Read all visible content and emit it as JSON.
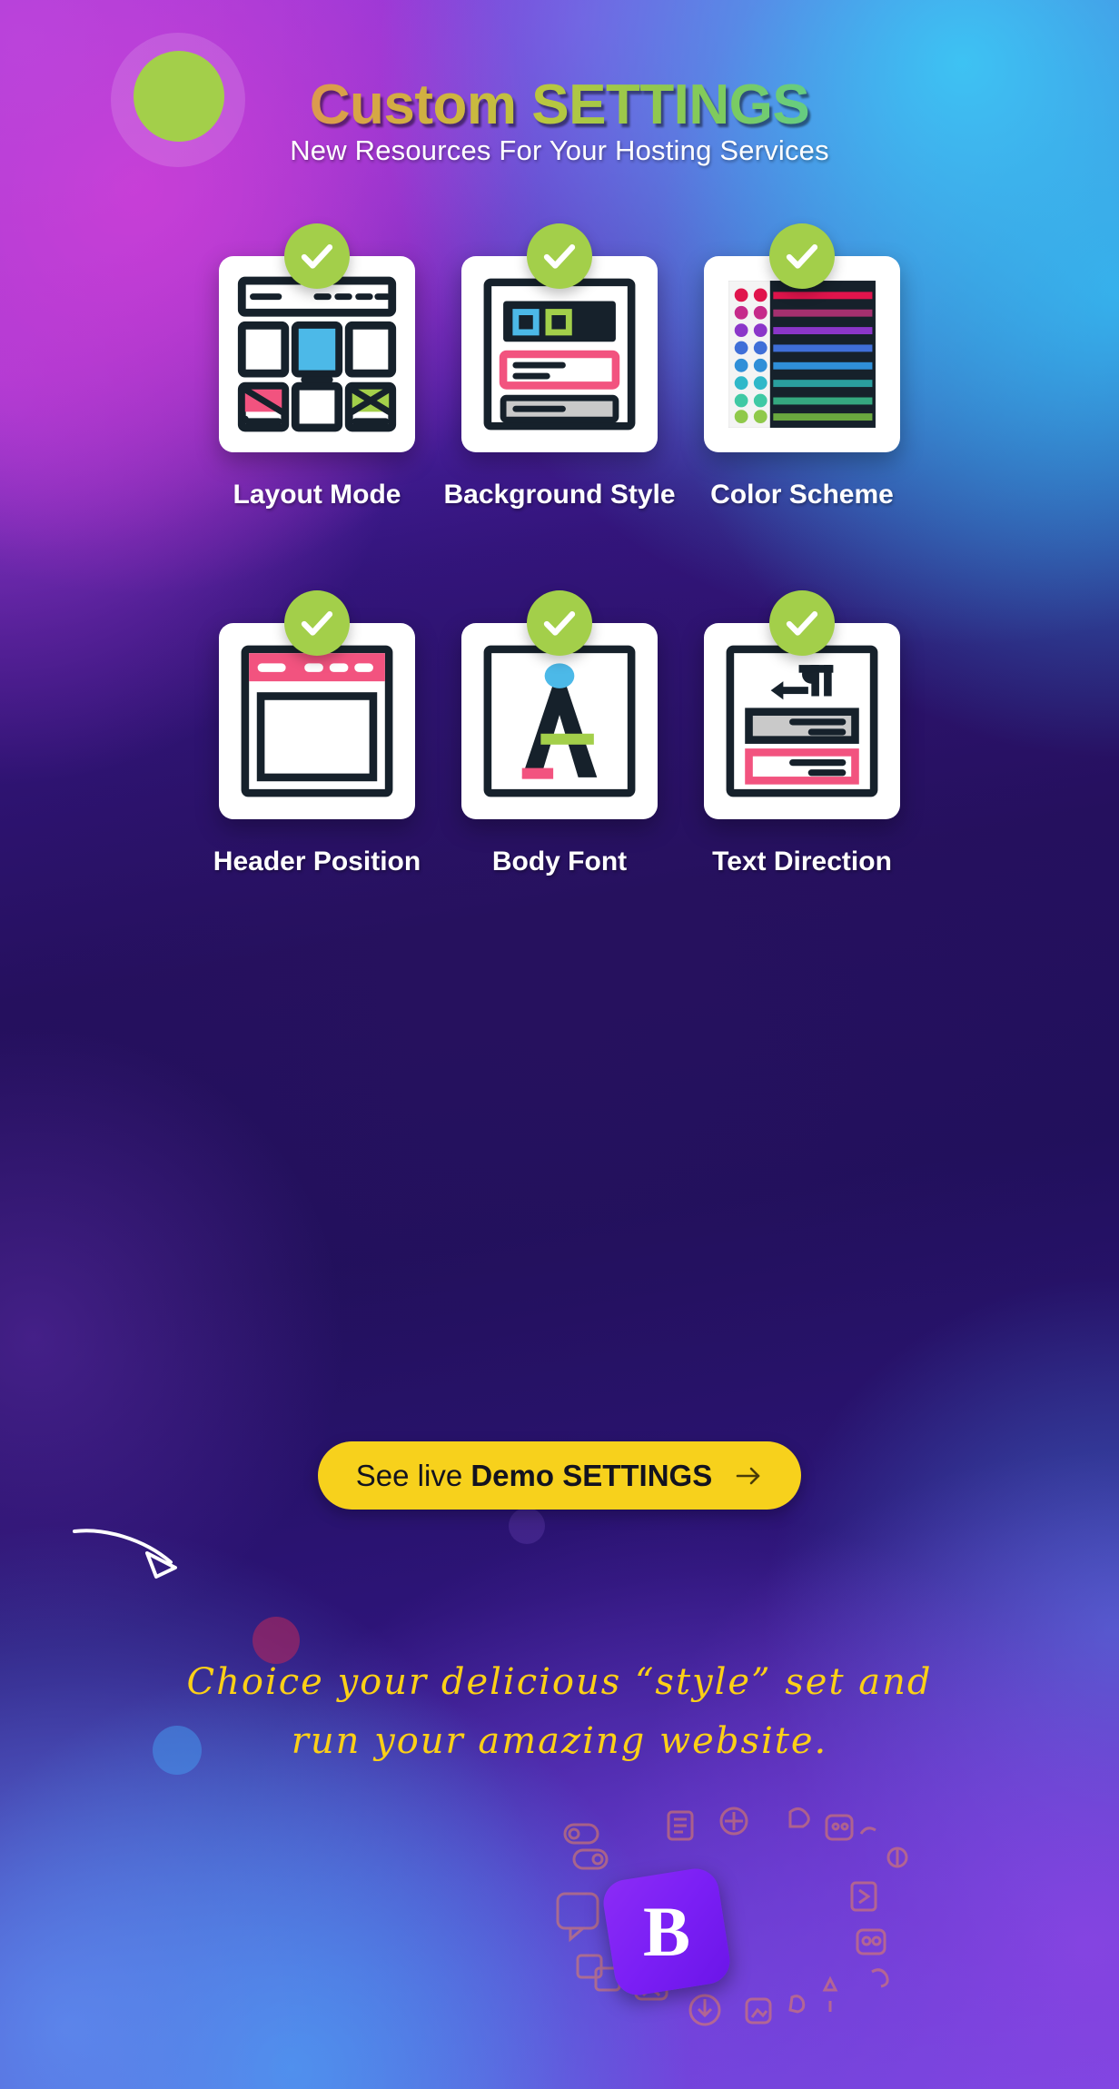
{
  "header": {
    "title_part1": "Custom",
    "title_part2": "SETTINGS",
    "title_full": "Custom SETTINGS",
    "subtitle": "New Resources For Your Hosting Services"
  },
  "colors": {
    "badge_green": "#a3cf4a",
    "cta_yellow": "#f7d11c",
    "script_yellow": "#fcd017",
    "card_white": "#ffffff",
    "ink_dark": "#16212b",
    "accent_pink": "#f2537f",
    "accent_blue": "#4cb9e8",
    "accent_green": "#a3cf4a",
    "accent_grey": "#c9c9c9",
    "logo_purple": "#7b1ff5"
  },
  "features": [
    {
      "id": "layout-mode",
      "label": "Layout Mode",
      "icon": "layout-grid-icon",
      "checked": true,
      "check_icon": "check-icon"
    },
    {
      "id": "background-style",
      "label": "Background Style",
      "icon": "background-image-icon",
      "checked": true,
      "check_icon": "check-icon"
    },
    {
      "id": "color-scheme",
      "label": "Color Scheme",
      "icon": "color-palette-icon",
      "checked": true,
      "check_icon": "check-icon"
    },
    {
      "id": "header-position",
      "label": "Header Position",
      "icon": "header-bar-icon",
      "checked": true,
      "check_icon": "check-icon"
    },
    {
      "id": "body-font",
      "label": "Body Font",
      "icon": "typography-a-icon",
      "checked": true,
      "check_icon": "check-icon"
    },
    {
      "id": "text-direction",
      "label": "Text Direction",
      "icon": "text-direction-icon",
      "checked": true,
      "check_icon": "check-icon"
    }
  ],
  "cta": {
    "label_light": "See live ",
    "label_bold": "Demo SETTINGS",
    "arrow_icon": "arrow-right-icon"
  },
  "doodle": {
    "icon": "curved-arrow-icon"
  },
  "script_note": {
    "line1": "Choice your delicious “style” set and",
    "line2": "run your amazing website."
  },
  "logo": {
    "letter": "B",
    "name": "bootstrap-logo"
  }
}
